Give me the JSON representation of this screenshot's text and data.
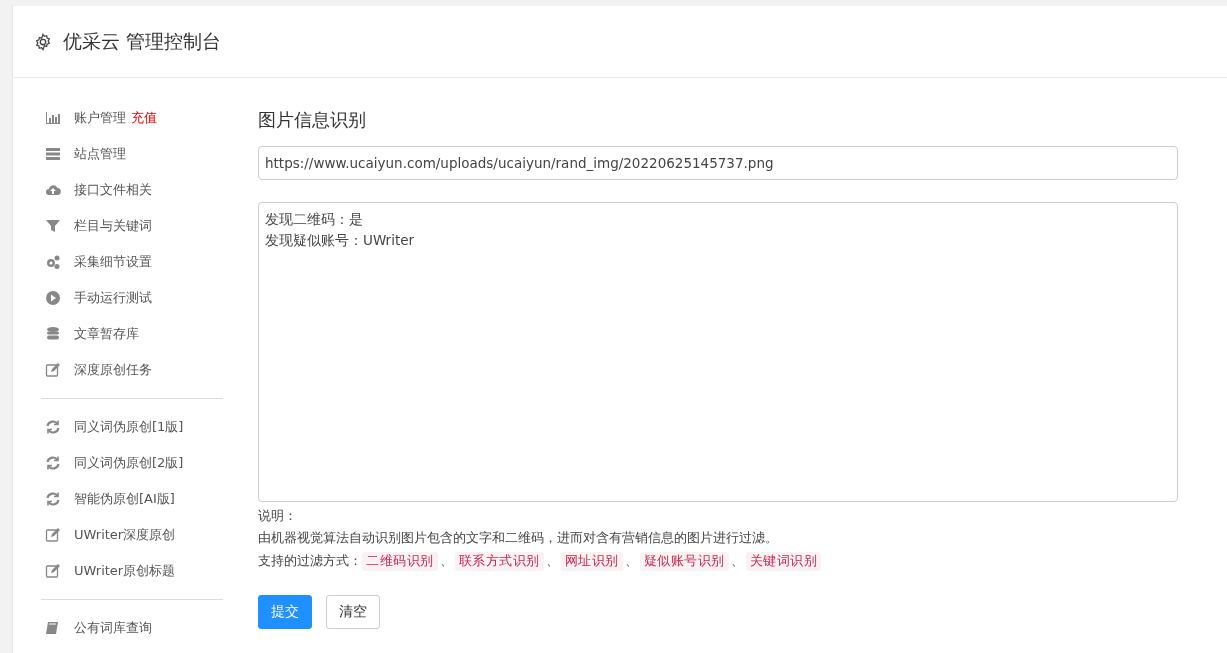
{
  "header": {
    "title": "优采云 管理控制台"
  },
  "sidebar": {
    "groups": [
      [
        {
          "label": "账户管理",
          "badge": "充值"
        },
        {
          "label": "站点管理"
        },
        {
          "label": "接口文件相关"
        },
        {
          "label": "栏目与关键词"
        },
        {
          "label": "采集细节设置"
        },
        {
          "label": "手动运行测试"
        },
        {
          "label": "文章暂存库"
        },
        {
          "label": "深度原创任务"
        }
      ],
      [
        {
          "label": "同义词伪原创[1版]"
        },
        {
          "label": "同义词伪原创[2版]"
        },
        {
          "label": "智能伪原创[AI版]"
        },
        {
          "label": "UWriter深度原创"
        },
        {
          "label": "UWriter原创标题"
        }
      ],
      [
        {
          "label": "公有词库查询"
        }
      ]
    ]
  },
  "main": {
    "title": "图片信息识别",
    "url_field": {
      "value": "https://www.ucaiyun.com/uploads/ucaiyun/rand_img/20220625145737.png"
    },
    "result_box": {
      "lines": [
        "发现二维码：是",
        "发现疑似账号：UWriter"
      ]
    },
    "notes_heading": "说明：",
    "description": "由机器视觉算法自动识别图片包含的文字和二维码，进而对含有营销信息的图片进行过滤。",
    "filters_label": "支持的过滤方式：",
    "filter_separator": "、",
    "filters": [
      "二维码识别",
      "联系方式识别",
      "网址识别",
      "疑似账号识别",
      "关键词识别"
    ],
    "buttons": [
      {
        "label": "提交",
        "kind": "primary"
      },
      {
        "label": "清空",
        "kind": "default"
      }
    ]
  }
}
